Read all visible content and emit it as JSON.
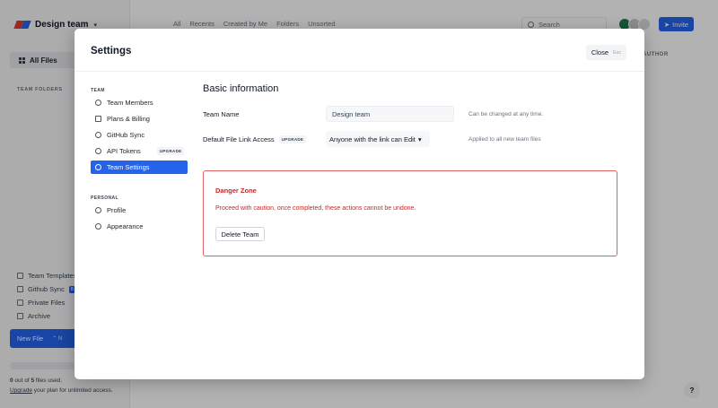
{
  "app": {
    "team_name": "Design team",
    "top_nav": [
      "All",
      "Recents",
      "Created by Me",
      "Folders",
      "Unsorted"
    ],
    "search_placeholder": "Search",
    "invite_label": "Invite",
    "column_author": "AUTHOR",
    "help_label": "?",
    "sidebar": {
      "all_files": "All Files",
      "team_folders_label": "TEAM FOLDERS",
      "links": [
        {
          "label": "Team Templates",
          "icon": "layers-icon"
        },
        {
          "label": "Github Sync",
          "icon": "github-icon",
          "badge": "B"
        },
        {
          "label": "Private Files",
          "icon": "file-icon"
        },
        {
          "label": "Archive",
          "icon": "archive-icon"
        }
      ],
      "new_file": "New File",
      "new_file_shortcut": "⌃ N",
      "usage_count": "0",
      "usage_mid": " out of ",
      "usage_total": "5",
      "usage_suffix": " files used.",
      "upgrade_link": "Upgrade",
      "upgrade_text": " your plan for unlimited access."
    },
    "avatar_colors": [
      "#1f7a4d",
      "#c7c9cc",
      "#d9dbde"
    ]
  },
  "modal": {
    "title": "Settings",
    "close_label": "Close",
    "close_shortcut": "Esc",
    "nav": {
      "team_section": "TEAM",
      "team_items": [
        {
          "label": "Team Members",
          "icon": "users-icon"
        },
        {
          "label": "Plans & Billing",
          "icon": "receipt-icon"
        },
        {
          "label": "GitHub Sync",
          "icon": "github-icon"
        },
        {
          "label": "API Tokens",
          "icon": "key-icon",
          "badge": "UPGRADE"
        },
        {
          "label": "Team Settings",
          "icon": "gear-icon",
          "active": true
        }
      ],
      "personal_section": "PERSONAL",
      "personal_items": [
        {
          "label": "Profile",
          "icon": "user-circle-icon"
        },
        {
          "label": "Appearance",
          "icon": "eye-icon"
        }
      ]
    },
    "content": {
      "title": "Basic information",
      "team_name_label": "Team Name",
      "team_name_value": "Design team",
      "team_name_hint": "Can be changed at any time.",
      "link_access_label": "Default File Link Access",
      "link_access_badge": "UPGRADE",
      "link_access_value": "Anyone with the link can Edit",
      "link_access_hint": "Applied to all new team files",
      "danger": {
        "title": "Danger Zone",
        "text": "Proceed with caution, once completed, these actions cannot be undone.",
        "delete_label": "Delete Team"
      }
    }
  },
  "colors": {
    "accent": "#2563eb",
    "danger": "#c62828",
    "danger_border": "#e06161"
  }
}
